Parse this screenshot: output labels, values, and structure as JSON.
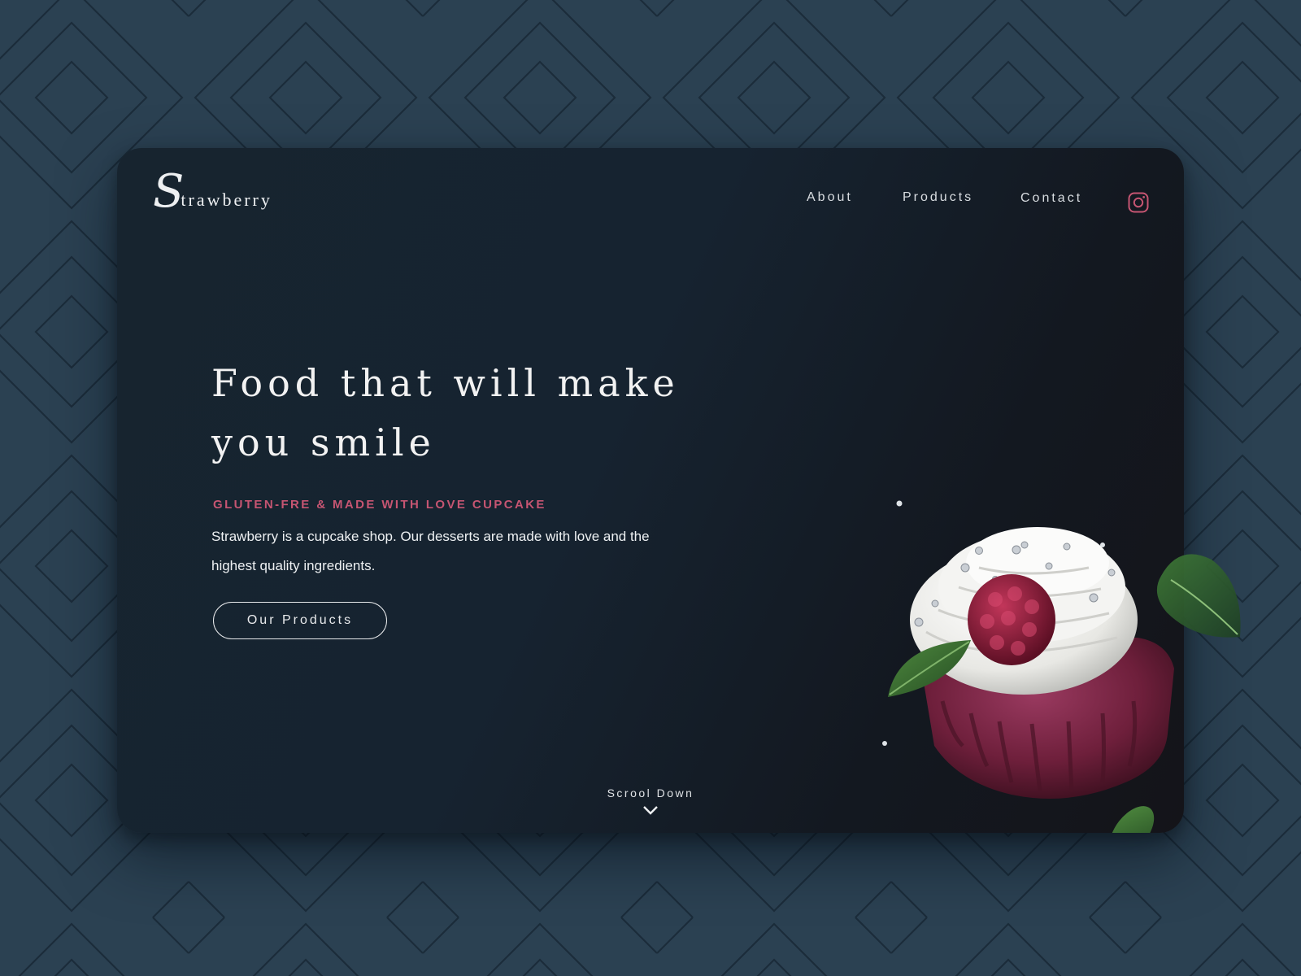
{
  "brand": {
    "initial": "S",
    "rest": "trawberry"
  },
  "nav": {
    "items": [
      {
        "label": "About"
      },
      {
        "label": "Products"
      },
      {
        "label": "Contact"
      }
    ]
  },
  "hero": {
    "title_line1": "Food that will make",
    "title_line2": "you smile",
    "tagline": "Gluten-Fre & Made With Love cupcake",
    "description": "Strawberry is a cupcake shop. Our desserts are made with love and the highest quality ingredients.",
    "cta_label": "Our Products"
  },
  "scroll": {
    "label": "Scrool Down"
  },
  "icons": {
    "social": "instagram-icon",
    "scroll": "chevron-down-icon"
  },
  "colors": {
    "page_background": "#2b4152",
    "pattern_stroke": "#1b2c3a",
    "card_background": "#162330",
    "accent": "#c65572",
    "text": "#eef1f3"
  }
}
